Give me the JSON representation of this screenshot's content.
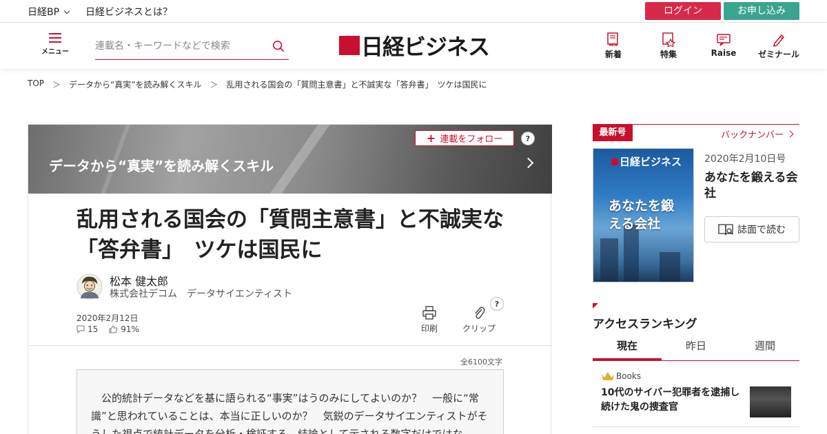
{
  "topbar": {
    "nikkei_bp": "日経BP",
    "about": "日経ビジネスとは？",
    "login": "ログイン",
    "apply": "お申し込み"
  },
  "header": {
    "menu_label": "メニュー",
    "search_placeholder": "連載名・キーワードなどで検索",
    "logo_text": "日経ビジネス",
    "nav": [
      {
        "label": "新着",
        "icon": "new-icon"
      },
      {
        "label": "特集",
        "icon": "feature-icon"
      },
      {
        "label": "Raise",
        "icon": "raise-icon"
      },
      {
        "label": "ゼミナール",
        "icon": "pen-icon"
      }
    ]
  },
  "breadcrumb": [
    "TOP",
    "データから“真実”を読み解くスキル",
    "乱用される国会の「質問主意書」と不誠実な「答弁書」　ツケは国民に"
  ],
  "article": {
    "series_title": "データから“真実”を読み解くスキル",
    "follow_label": "連載をフォロー",
    "headline": "乱用される国会の「質問主意書」と不誠実な「答弁書」　ツケは国民に",
    "author_name": "松本 健太郎",
    "author_org": "株式会社デコム　データサイエンティスト",
    "date": "2020年2月12日",
    "comments": "15",
    "likes": "91%",
    "print_label": "印刷",
    "clip_label": "クリップ",
    "help": "?",
    "char_count": "全6100文字",
    "lead": "公的統計データなどを基に語られる“事実”はうのみにしてよいのか？　一般に“常識”と思われていることは、本当に正しいのか？　気鋭のデータサイエンティストがそうした視点で統計データを分析・検証する。結論として示される数字だけではな"
  },
  "sidebar": {
    "latest_tag": "最新号",
    "backnumber": "バックナンバー",
    "cover_logo": "日経ビジネス",
    "cover_title": "あなたを鍛える会社",
    "issue_date": "2020年2月10日号",
    "issue_title": "あなたを鍛える会社",
    "read_label": "誌面で読む",
    "ranking_title": "アクセスランキング",
    "tabs": [
      "現在",
      "昨日",
      "週間"
    ],
    "rank_item": {
      "category": "Books",
      "headline": "10代のサイバー犯罪者を逮捕し続けた鬼の捜査官"
    }
  },
  "colors": {
    "brand_red": "#c8102e",
    "login_red": "#d9294a",
    "apply_green": "#3aa58f"
  }
}
